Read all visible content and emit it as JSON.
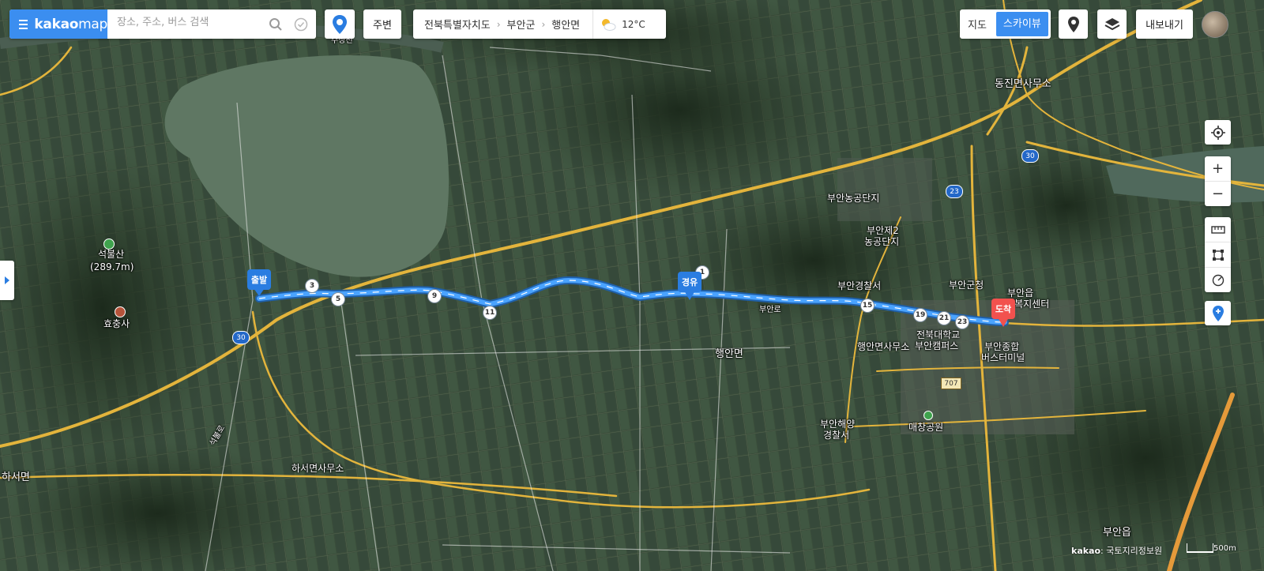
{
  "brand": {
    "logo_main": "kakao",
    "logo_sub": "map"
  },
  "search": {
    "placeholder": "장소, 주소, 버스 검색"
  },
  "toolbar": {
    "near_label": "주변",
    "breadcrumb": [
      "전북특별자치도",
      "부안군",
      "행안면"
    ],
    "temperature": "12°C",
    "map_type": {
      "normal": "지도",
      "skyview": "스카이뷰",
      "selected": "스카이뷰"
    },
    "export_label": "내보내기"
  },
  "route": {
    "start_label": "출발",
    "via_label": "경유",
    "end_label": "도착",
    "waypoints": [
      "1",
      "3",
      "5",
      "9",
      "11",
      "15",
      "19",
      "21",
      "23"
    ]
  },
  "places": {
    "seokbulsan": "석불산",
    "seokbulsan_elev": "(289.7m)",
    "hyochungsa": "효충사",
    "dongjin_office": "동진면사무소",
    "buan_industrial": "부안농공단지",
    "buan_industrial2_a": "부안제2",
    "buan_industrial2_b": "농공단지",
    "police_station": "부안경찰서",
    "buan_county": "부안군청",
    "buan_welfare_a": "부안읍",
    "buan_welfare_b": "행정복지센터",
    "haengan_office": "행안면사무소",
    "jeonbuk_campus_a": "전북대학교",
    "jeonbuk_campus_b": "부안캠퍼스",
    "terminal_a": "부안종합",
    "terminal_b": "버스터미널",
    "haengan": "행안면",
    "coast_guard_a": "부안해양",
    "coast_guard_b": "경찰서",
    "maechang_park": "매창공원",
    "haseo_office": "하서면사무소",
    "haseo": "하서면",
    "buan_eup": "부안읍",
    "road_jusang": "주상천",
    "road_buan": "부안로",
    "road_seokbul": "석불로"
  },
  "road_badges": {
    "r30": "30",
    "r23": "23",
    "r707": "707"
  },
  "footer": {
    "copyright_brand": "kakao",
    "copyright_text": "국토지리정보원",
    "scale": "500m"
  },
  "colors": {
    "accent": "#3b8ef0",
    "route": "#4aa3ff",
    "end_pin": "#f2514e",
    "road": "#e3b43c"
  }
}
